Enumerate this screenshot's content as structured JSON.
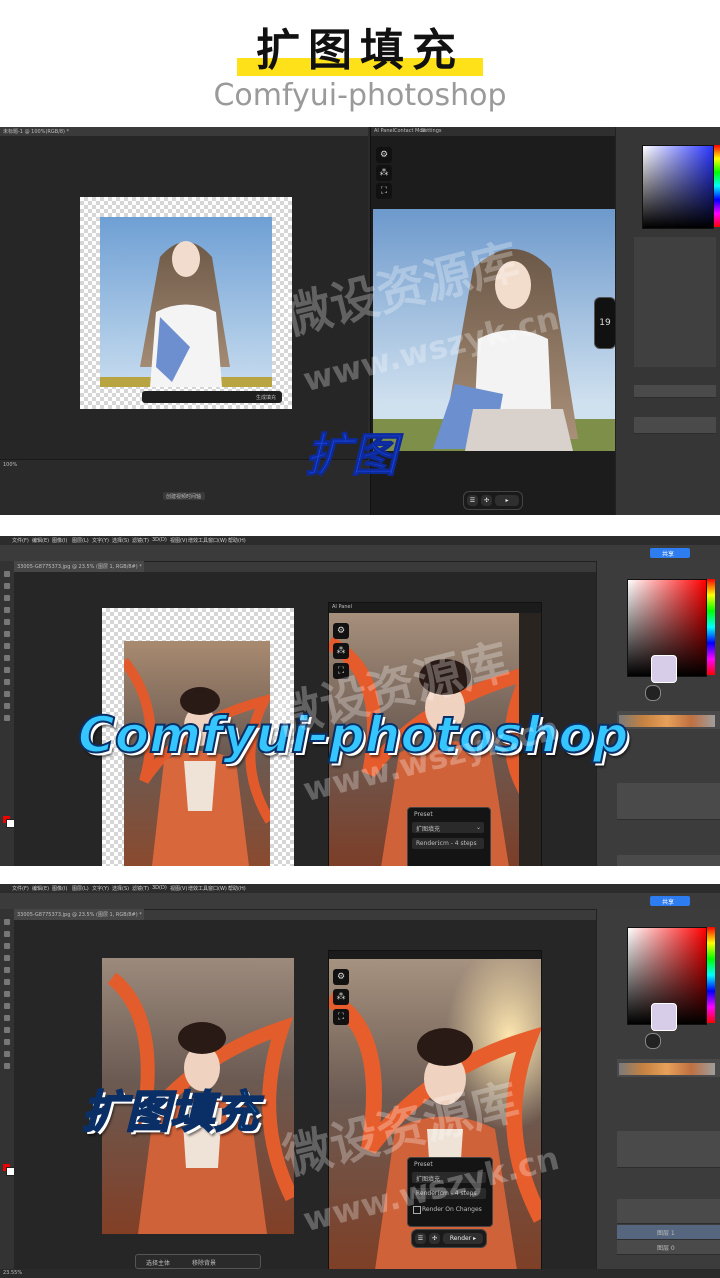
{
  "header": {
    "title": "扩图填充",
    "subtitle": "Comfyui-photoshop"
  },
  "shot1": {
    "doc_tab": "未标题-1 @ 100%(RGB/8) *",
    "ai_tabs": [
      "AI Panel",
      "Contact Mod",
      "Settings"
    ],
    "frame_label": "19",
    "ctx_action": "生成填充",
    "handwriting": "扩图",
    "zoom": "100%",
    "timeline_btn": "创建视频时间轴"
  },
  "shot2": {
    "menu": [
      "文件(F)",
      "编辑(E)",
      "图像(I)",
      "图层(L)",
      "文字(Y)",
      "选择(S)",
      "滤镜(T)",
      "3D(D)",
      "视图(V)",
      "增效工具",
      "窗口(W)",
      "帮助(H)"
    ],
    "doc_tab": "33005-G8775373.jpg @ 23.5% (图层 1, RGB/8#) *",
    "ai_panel_title": "AI Panel",
    "preset_header": "Preset",
    "preset_value": "扩图填充",
    "render_label": "Render:",
    "render_value": "icm - 4 steps",
    "overlay_text": "Comfyui-photoshop",
    "share_btn": "共享",
    "search_icon": "search-icon"
  },
  "shot3": {
    "doc_tab": "33005-G8775373.jpg @ 23.5% (图层 1, RGB/8#) *",
    "preset_header": "Preset",
    "preset_value": "扩图填充",
    "render_label": "Render:",
    "render_value": "icm - 4 steps",
    "option_label": "Render On Changes",
    "dock_render": "Render",
    "overlay_text": "扩图填充",
    "zoom": "23.55%",
    "bottom_btns": [
      "选择主体",
      "移除背景"
    ],
    "layer_names": [
      "图层 1",
      "图层 0"
    ]
  },
  "watermark": {
    "cn": "微设资源库",
    "url": "www.wszyk.cn"
  },
  "colors": {
    "highlight": "#ffe119",
    "overlay_blue": "#35c6ff",
    "hand_blue": "#1b46e8",
    "ps_dark": "#2b2b2b"
  }
}
